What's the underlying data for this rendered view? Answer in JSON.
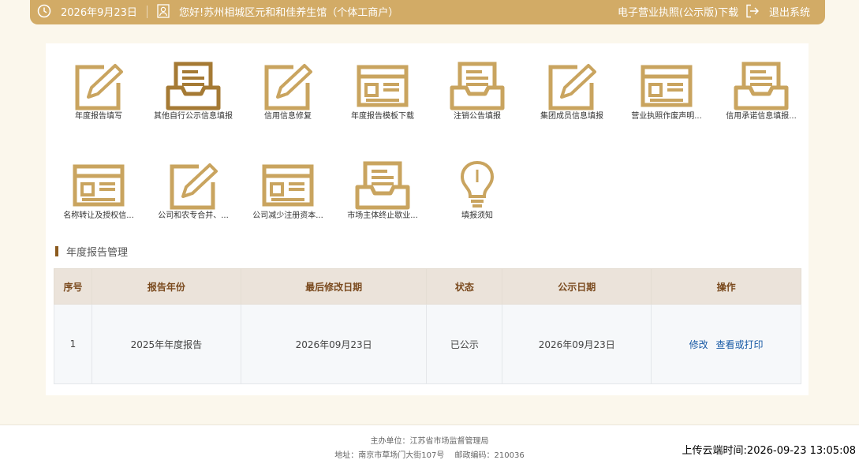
{
  "header": {
    "date": "2026年9月23日",
    "greeting": "您好!苏州相城区元和和佳养生馆（个体工商户）",
    "license_download": "电子营业执照(公示版)下载",
    "logout": "退出系统"
  },
  "tiles": [
    {
      "label": "年度报告填写",
      "icon": "pencil-icon"
    },
    {
      "label": "其他自行公示信息填报",
      "icon": "inbox-icon"
    },
    {
      "label": "信用信息修复",
      "icon": "pencil-icon"
    },
    {
      "label": "年度报告模板下载",
      "icon": "window-icon"
    },
    {
      "label": "注销公告填报",
      "icon": "inbox-icon"
    },
    {
      "label": "集团成员信息填报",
      "icon": "pencil-icon"
    },
    {
      "label": "营业执照作废声明...",
      "icon": "window-icon"
    },
    {
      "label": "信用承诺信息填报...",
      "icon": "inbox-icon"
    },
    {
      "label": "名称转让及授权信...",
      "icon": "window-icon"
    },
    {
      "label": "公司和农专合并、...",
      "icon": "pencil-icon"
    },
    {
      "label": "公司减少注册资本...",
      "icon": "window-icon"
    },
    {
      "label": "市场主体终止歇业...",
      "icon": "inbox-icon"
    },
    {
      "label": "填报须知",
      "icon": "lightbulb-icon"
    }
  ],
  "section": {
    "title": "年度报告管理"
  },
  "table": {
    "headers": [
      "序号",
      "报告年份",
      "最后修改日期",
      "状态",
      "公示日期",
      "操作"
    ],
    "rows": [
      {
        "no": "1",
        "year": "2025年年度报告",
        "modified": "2026年09月23日",
        "status": "已公示",
        "published": "2026年09月23日",
        "edit": "修改",
        "view": "查看或打印"
      }
    ]
  },
  "footer": {
    "organizer": "主办单位：江苏省市场监督管理局",
    "address": "地址：南京市草场门大街107号　 邮政编码：210036"
  },
  "upload_time": "上传云端时间:2026-09-23 13:05:08",
  "colors": {
    "gold": "#d2ab66",
    "icon_gold": "#c9a45f",
    "icon_brown": "#a57a34",
    "link": "#1a5ba6"
  }
}
